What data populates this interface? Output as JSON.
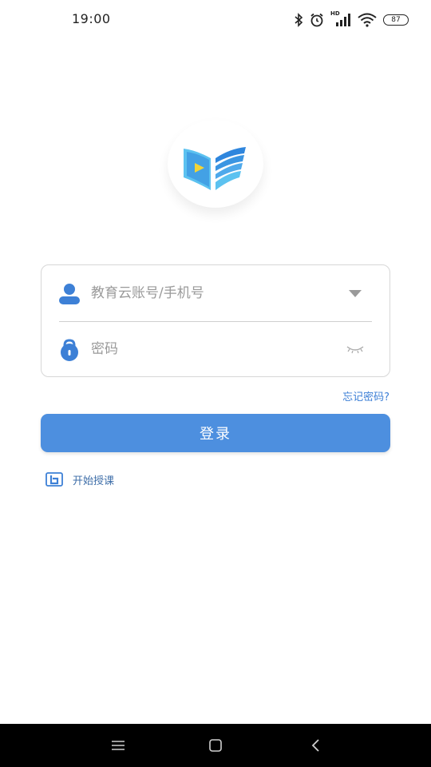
{
  "status_bar": {
    "time": "19:00",
    "network_label": "HD",
    "battery_level": "87",
    "icons": [
      "bluetooth-icon",
      "alarm-icon",
      "signal-icon",
      "wifi-icon",
      "battery-icon"
    ]
  },
  "app": {
    "logo_icon": "book-play-logo-icon",
    "brand_colors": {
      "primary": "#4d8fdf",
      "logo_light": "#5cc2f0",
      "logo_dark": "#2f86dd",
      "play": "#f2d437"
    }
  },
  "login_form": {
    "account_placeholder": "教育云账号/手机号",
    "password_placeholder": "密码",
    "account_icon": "user-icon",
    "password_icon": "lock-icon",
    "dropdown_icon": "triangle-down-icon",
    "visibility_icon": "eye-closed-icon",
    "forgot_password": "忘记密码?",
    "login_button": "登录"
  },
  "secondary_action": {
    "icon": "teach-icon",
    "label": "开始授课"
  },
  "nav_bar": {
    "icons": [
      "menu-icon",
      "home-icon",
      "back-icon"
    ]
  }
}
